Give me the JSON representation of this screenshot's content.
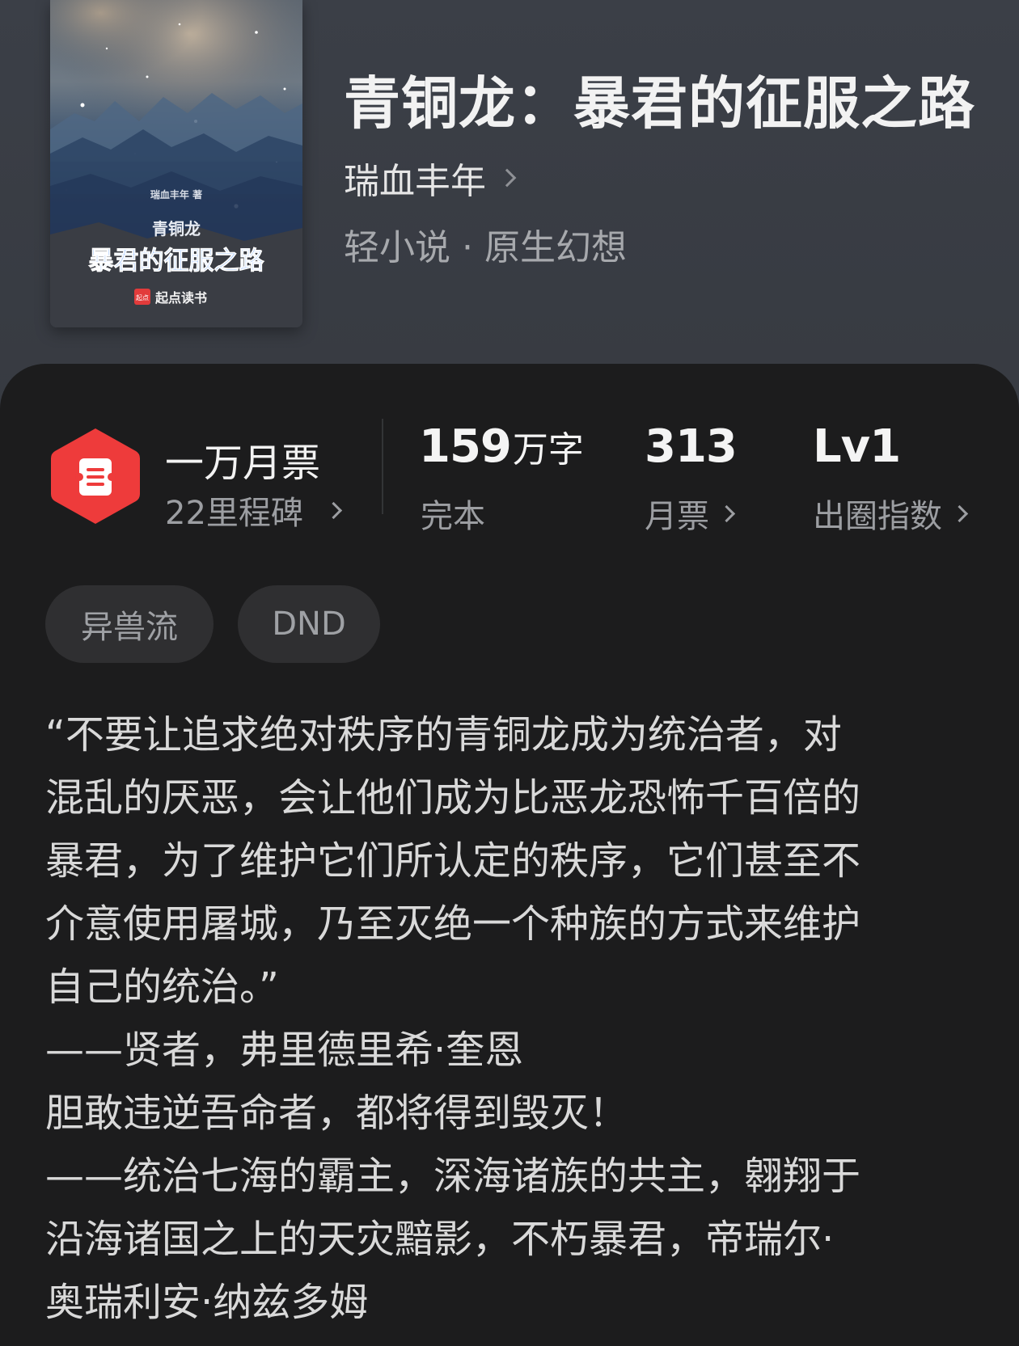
{
  "book": {
    "title": "青铜龙：暴君的征服之路",
    "author": "瑞血丰年",
    "category": "轻小说",
    "subcategory": "原生幻想",
    "category_separator": "·",
    "cover": {
      "author_line": "瑞血丰年 著",
      "title_small": "青铜龙",
      "title_main": "暴君的征服之路",
      "publisher": "起点读书",
      "publisher_badge": "起点"
    }
  },
  "stats": {
    "monthly_ticket_tier": "一万月票",
    "milestone": "22里程碑",
    "word_count_number": "159",
    "word_count_unit": "万字",
    "status": "完本",
    "monthly_tickets": "313",
    "monthly_tickets_label": "月票",
    "breakout_level": "Lv1",
    "breakout_label": "出圈指数"
  },
  "tags": [
    "异兽流",
    "DND"
  ],
  "synopsis": {
    "lines": [
      "“不要让追求绝对秩序的青铜龙成为统治者，对",
      "混乱的厌恶，会让他们成为比恶龙恐怖千百倍的",
      "暴君，为了维护它们所认定的秩序，它们甚至不",
      "介意使用屠城，乃至灭绝一个种族的方式来维护",
      "自己的统治。”",
      "——贤者，弗里德里希·奎恩",
      "胆敢违逆吾命者，都将得到毁灭！",
      "——统治七海的霸主，深海诸族的共主，翱翔于",
      "沿海诸国之上的天灾黯影，不朽暴君，帝瑞尔·",
      "奥瑞利安·纳兹多姆"
    ]
  },
  "colors": {
    "header_bg": "#3b3f47",
    "sheet_bg": "#1c1c1d",
    "badge_red": "#ee3b3b",
    "tag_bg": "#2f2f31",
    "muted_text": "#9c9ea2",
    "cover_title_blue": "#7fb0ff"
  },
  "icons": {
    "monthly_badge": "ticket-hexagon-icon",
    "chevron": "chevron-right-icon"
  }
}
